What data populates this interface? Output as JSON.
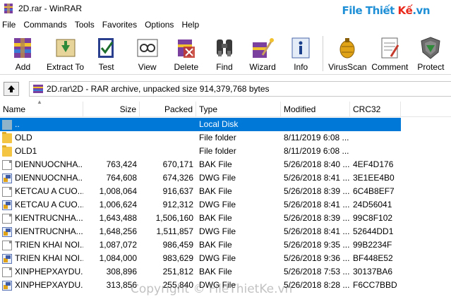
{
  "window": {
    "title": "2D.rar - WinRAR"
  },
  "brand": {
    "part1": "File Thiết ",
    "part2": "Kế",
    "part3": ".vn"
  },
  "menu": [
    "File",
    "Commands",
    "Tools",
    "Favorites",
    "Options",
    "Help"
  ],
  "toolbar": [
    {
      "label": "Add",
      "icon": "add-icon"
    },
    {
      "label": "Extract To",
      "icon": "extract-icon"
    },
    {
      "label": "Test",
      "icon": "test-icon"
    },
    {
      "label": "View",
      "icon": "view-icon"
    },
    {
      "label": "Delete",
      "icon": "delete-icon"
    },
    {
      "label": "Find",
      "icon": "find-icon"
    },
    {
      "label": "Wizard",
      "icon": "wizard-icon"
    },
    {
      "label": "Info",
      "icon": "info-icon"
    },
    {
      "label": "VirusScan",
      "icon": "virusscan-icon"
    },
    {
      "label": "Comment",
      "icon": "comment-icon"
    },
    {
      "label": "Protect",
      "icon": "protect-icon"
    }
  ],
  "address": {
    "path": "2D.rar\\2D - RAR archive, unpacked size 914,379,768 bytes"
  },
  "columns": {
    "name": "Name",
    "size": "Size",
    "packed": "Packed",
    "type": "Type",
    "modified": "Modified",
    "crc": "CRC32"
  },
  "files": [
    {
      "name": "..",
      "size": "",
      "packed": "",
      "type": "Local Disk",
      "modified": "",
      "crc": "",
      "icon": "updir",
      "selected": true
    },
    {
      "name": "OLD",
      "size": "",
      "packed": "",
      "type": "File folder",
      "modified": "8/11/2019 6:08 ...",
      "crc": "",
      "icon": "folder"
    },
    {
      "name": "OLD1",
      "size": "",
      "packed": "",
      "type": "File folder",
      "modified": "8/11/2019 6:08 ...",
      "crc": "",
      "icon": "folder"
    },
    {
      "name": "DIENNUOCNHA...",
      "size": "763,424",
      "packed": "670,171",
      "type": "BAK File",
      "modified": "5/26/2018 8:40 ...",
      "crc": "4EF4D176",
      "icon": "file"
    },
    {
      "name": "DIENNUOCNHA...",
      "size": "764,608",
      "packed": "674,326",
      "type": "DWG File",
      "modified": "5/26/2018 8:41 ...",
      "crc": "3E1EE4B0",
      "icon": "dwg"
    },
    {
      "name": "KETCAU A CUO...",
      "size": "1,008,064",
      "packed": "916,637",
      "type": "BAK File",
      "modified": "5/26/2018 8:39 ...",
      "crc": "6C4B8EF7",
      "icon": "file"
    },
    {
      "name": "KETCAU A CUO...",
      "size": "1,006,624",
      "packed": "912,312",
      "type": "DWG File",
      "modified": "5/26/2018 8:41 ...",
      "crc": "24D56041",
      "icon": "dwg"
    },
    {
      "name": "KIENTRUCNHA...",
      "size": "1,643,488",
      "packed": "1,506,160",
      "type": "BAK File",
      "modified": "5/26/2018 8:39 ...",
      "crc": "99C8F102",
      "icon": "file"
    },
    {
      "name": "KIENTRUCNHA...",
      "size": "1,648,256",
      "packed": "1,511,857",
      "type": "DWG File",
      "modified": "5/26/2018 8:41 ...",
      "crc": "52644DD1",
      "icon": "dwg"
    },
    {
      "name": "TRIEN KHAI NOI...",
      "size": "1,087,072",
      "packed": "986,459",
      "type": "BAK File",
      "modified": "5/26/2018 9:35 ...",
      "crc": "99B2234F",
      "icon": "file"
    },
    {
      "name": "TRIEN KHAI NOI...",
      "size": "1,084,000",
      "packed": "983,629",
      "type": "DWG File",
      "modified": "5/26/2018 9:36 ...",
      "crc": "BF448E52",
      "icon": "dwg"
    },
    {
      "name": "XINPHEPXAYDU...",
      "size": "308,896",
      "packed": "251,812",
      "type": "BAK File",
      "modified": "5/26/2018 7:53 ...",
      "crc": "30137BA6",
      "icon": "file"
    },
    {
      "name": "XINPHEPXAYDU...",
      "size": "313,856",
      "packed": "255,840",
      "type": "DWG File",
      "modified": "5/26/2018 8:28 ...",
      "crc": "F6CC7BBD",
      "icon": "dwg"
    }
  ],
  "watermark": "Copyright © FileThietKe.vn",
  "colors": {
    "selection": "#0078d7",
    "brand_blue": "#1f8fd6",
    "brand_red": "#e8291c"
  }
}
